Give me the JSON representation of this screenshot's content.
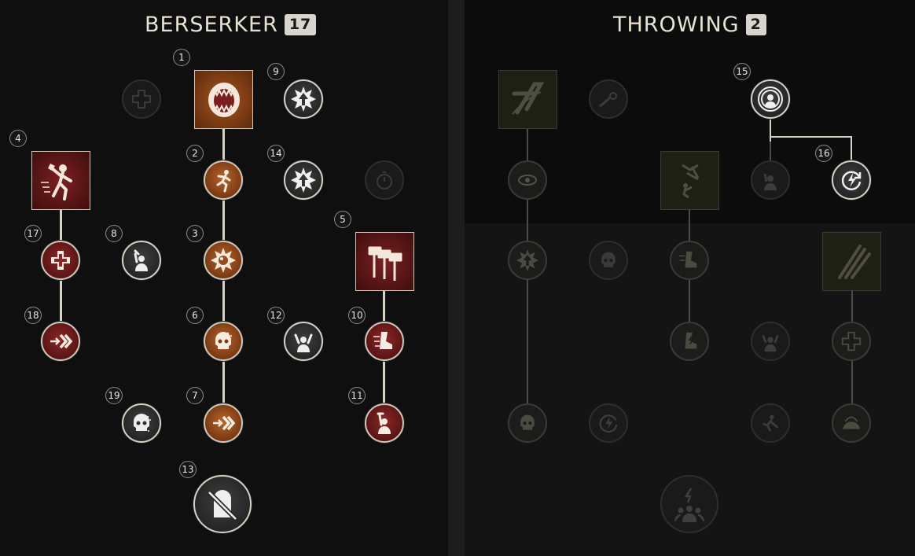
{
  "trees": {
    "left": {
      "title": "BERSERKER",
      "points": "17"
    },
    "right": {
      "title": "THROWING",
      "points": "2"
    }
  },
  "skill_numbers": {
    "n1": "1",
    "n2": "2",
    "n3": "3",
    "n4": "4",
    "n5": "5",
    "n6": "6",
    "n7": "7",
    "n8": "8",
    "n9": "9",
    "n10": "10",
    "n11": "11",
    "n12": "12",
    "n13": "13",
    "n14": "14",
    "n15": "15",
    "n16": "16",
    "n17": "17",
    "n18": "18",
    "n19": "19"
  },
  "icons": {
    "medical-cross-icon": "medical cross",
    "roaring-mouth-icon": "roaring mouth",
    "burst-arrow-icon": "burst with up arrow",
    "axe-thrower-icon": "figure swinging axe",
    "running-man-icon": "running man",
    "stopwatch-icon": "stopwatch",
    "flexing-man-icon": "man raising hammer",
    "explosion-icon": "explosion burst",
    "hammers-icon": "three hammers",
    "skull-icon": "skull",
    "speed-chevron-icon": "arrow chevrons",
    "speed-boot-icon": "winged boot",
    "gravestone-icon": "crossed out gravestone",
    "signal-person-icon": "person with signal rings",
    "lightning-cycle-icon": "lightning in cycle",
    "throw-slash-icon": "throwing slash",
    "comet-icon": "comet",
    "leaping-figure-icon": "leaping figure",
    "claw-marks-icon": "claw marks",
    "team-lightning-icon": "team with lightning"
  },
  "colors": {
    "active_orange": "#9a4a1a",
    "active_red": "#6e1c1c",
    "inactive_dim": "#3a3a36",
    "connector_active": "#d6d2c6",
    "title_text": "#e8e2d4"
  }
}
